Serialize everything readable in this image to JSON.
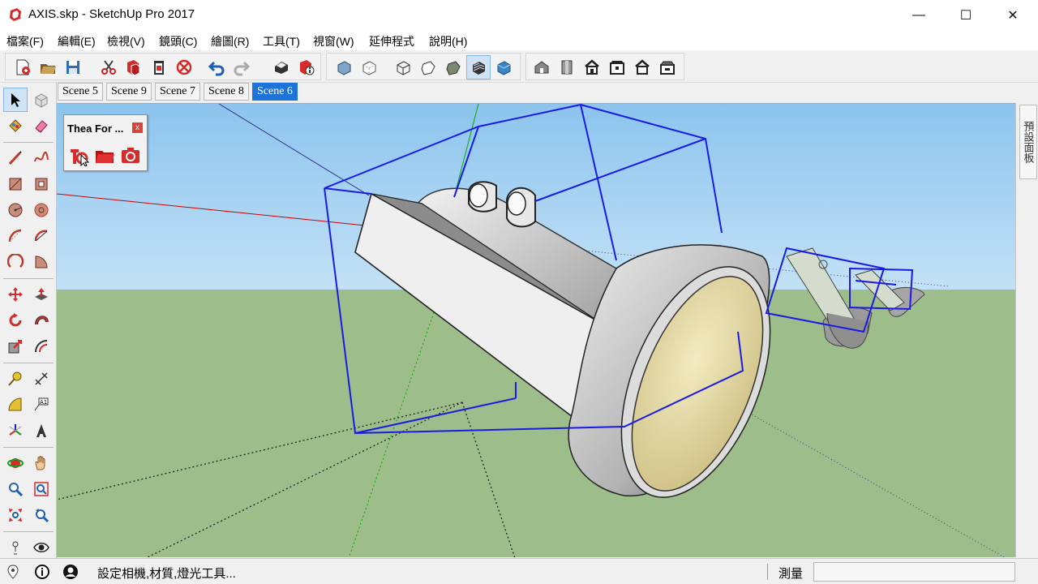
{
  "window": {
    "title": "AXIS.skp - SketchUp Pro 2017",
    "minimize": "—",
    "maximize": "☐",
    "close": "✕"
  },
  "menu": [
    {
      "label": "檔案(F)"
    },
    {
      "label": "編輯(E)"
    },
    {
      "label": "檢視(V)"
    },
    {
      "label": "鏡頭(C)"
    },
    {
      "label": "繪圖(R)"
    },
    {
      "label": "工具(T)"
    },
    {
      "label": "視窗(W)"
    },
    {
      "label": "延伸程式"
    },
    {
      "label": "說明(H)"
    }
  ],
  "toolbar_icons": [
    "new-file-icon",
    "open-folder-icon",
    "save-icon",
    "cut-icon",
    "copy-icon",
    "paste-icon",
    "erase-icon",
    "undo-icon",
    "redo-icon",
    "print-icon",
    "model-info-icon",
    "xray-style-icon",
    "back-edges-style-icon",
    "wireframe-style-icon",
    "hidden-line-style-icon",
    "shaded-style-icon",
    "shaded-textures-style-icon",
    "monochrome-style-icon",
    "iso-view-icon",
    "top-view-icon",
    "front-view-icon",
    "right-view-icon",
    "back-view-icon",
    "left-view-icon"
  ],
  "scenes": [
    {
      "label": "Scene 5"
    },
    {
      "label": "Scene 9"
    },
    {
      "label": "Scene 7"
    },
    {
      "label": "Scene 8"
    },
    {
      "label": "Scene 6",
      "active": true
    }
  ],
  "thea_panel": {
    "title": "Thea For ...",
    "close": "x",
    "buttons": [
      "thea-render-icon",
      "thea-folder-icon",
      "thea-camera-icon"
    ]
  },
  "right_tray": {
    "label": "預設面板"
  },
  "status": {
    "message": "設定相機,材質,燈光工具...",
    "measurements_label": "測量",
    "measurements_value": ""
  },
  "colors": {
    "sky": "#a9d3f2",
    "ground": "#9dbd8a",
    "selection": "#1a1ae6",
    "active_tab": "#1e73d8",
    "red_axis": "#cc0000",
    "green_axis": "#00aa00",
    "blue_axis": "#0000cc"
  }
}
